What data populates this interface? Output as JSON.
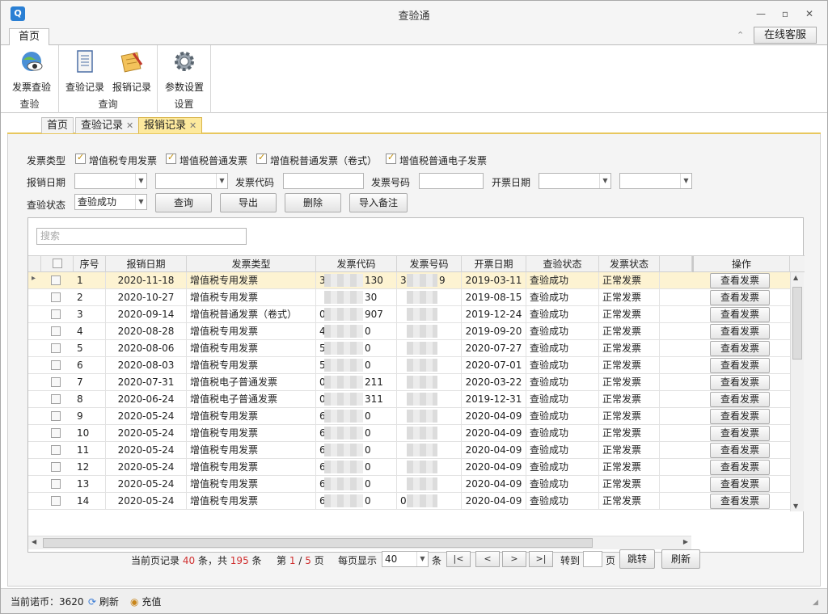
{
  "window": {
    "title": "查验通"
  },
  "ribbon": {
    "tab": "首页",
    "service_button": "在线客服",
    "groups": [
      {
        "label": "查验",
        "buttons": [
          "发票查验"
        ]
      },
      {
        "label": "查询",
        "buttons": [
          "查验记录",
          "报销记录"
        ]
      },
      {
        "label": "设置",
        "buttons": [
          "参数设置"
        ]
      }
    ]
  },
  "doc_tabs": [
    "首页",
    "查验记录",
    "报销记录"
  ],
  "filters": {
    "invoice_type_label": "发票类型",
    "types": [
      "增值税专用发票",
      "增值税普通发票",
      "增值税普通发票（卷式）",
      "增值税普通电子发票"
    ],
    "report_date_label": "报销日期",
    "code_label": "发票代码",
    "number_label": "发票号码",
    "issue_date_label": "开票日期",
    "status_label": "查验状态",
    "status_value": "查验成功",
    "buttons": [
      "查询",
      "导出",
      "删除",
      "导入备注"
    ]
  },
  "grid": {
    "search_placeholder": "搜索",
    "columns": [
      "序号",
      "报销日期",
      "发票类型",
      "发票代码",
      "发票号码",
      "开票日期",
      "查验状态",
      "发票状态",
      "操作"
    ],
    "view_label": "查看发票",
    "rows": [
      {
        "seq": "1",
        "rdate": "2020-11-18",
        "type": "增值税专用发票",
        "code_a": "3",
        "code_b": "130",
        "num_a": "3",
        "num_b": "9",
        "idate": "2019-03-11",
        "check": "查验成功",
        "state": "正常发票"
      },
      {
        "seq": "2",
        "rdate": "2020-10-27",
        "type": "增值税专用发票",
        "code_a": "",
        "code_b": "30",
        "num_a": "",
        "num_b": "",
        "idate": "2019-08-15",
        "check": "查验成功",
        "state": "正常发票"
      },
      {
        "seq": "3",
        "rdate": "2020-09-14",
        "type": "增值税普通发票（卷式）",
        "code_a": "0",
        "code_b": "907",
        "num_a": "",
        "num_b": "",
        "idate": "2019-12-24",
        "check": "查验成功",
        "state": "正常发票"
      },
      {
        "seq": "4",
        "rdate": "2020-08-28",
        "type": "增值税专用发票",
        "code_a": "4",
        "code_b": "0",
        "num_a": "",
        "num_b": "",
        "idate": "2019-09-20",
        "check": "查验成功",
        "state": "正常发票"
      },
      {
        "seq": "5",
        "rdate": "2020-08-06",
        "type": "增值税专用发票",
        "code_a": "5",
        "code_b": "0",
        "num_a": "",
        "num_b": "",
        "idate": "2020-07-27",
        "check": "查验成功",
        "state": "正常发票"
      },
      {
        "seq": "6",
        "rdate": "2020-08-03",
        "type": "增值税专用发票",
        "code_a": "5",
        "code_b": "0",
        "num_a": "",
        "num_b": "",
        "idate": "2020-07-01",
        "check": "查验成功",
        "state": "正常发票"
      },
      {
        "seq": "7",
        "rdate": "2020-07-31",
        "type": "增值税电子普通发票",
        "code_a": "0",
        "code_b": "211",
        "num_a": "",
        "num_b": "",
        "idate": "2020-03-22",
        "check": "查验成功",
        "state": "正常发票"
      },
      {
        "seq": "8",
        "rdate": "2020-06-24",
        "type": "增值税电子普通发票",
        "code_a": "0",
        "code_b": "311",
        "num_a": "",
        "num_b": "",
        "idate": "2019-12-31",
        "check": "查验成功",
        "state": "正常发票"
      },
      {
        "seq": "9",
        "rdate": "2020-05-24",
        "type": "增值税专用发票",
        "code_a": "6",
        "code_b": "0",
        "num_a": "",
        "num_b": "",
        "idate": "2020-04-09",
        "check": "查验成功",
        "state": "正常发票"
      },
      {
        "seq": "10",
        "rdate": "2020-05-24",
        "type": "增值税专用发票",
        "code_a": "6",
        "code_b": "0",
        "num_a": "",
        "num_b": "",
        "idate": "2020-04-09",
        "check": "查验成功",
        "state": "正常发票"
      },
      {
        "seq": "11",
        "rdate": "2020-05-24",
        "type": "增值税专用发票",
        "code_a": "6",
        "code_b": "0",
        "num_a": "",
        "num_b": "",
        "idate": "2020-04-09",
        "check": "查验成功",
        "state": "正常发票"
      },
      {
        "seq": "12",
        "rdate": "2020-05-24",
        "type": "增值税专用发票",
        "code_a": "6",
        "code_b": "0",
        "num_a": "",
        "num_b": "",
        "idate": "2020-04-09",
        "check": "查验成功",
        "state": "正常发票"
      },
      {
        "seq": "13",
        "rdate": "2020-05-24",
        "type": "增值税专用发票",
        "code_a": "6",
        "code_b": "0",
        "num_a": "",
        "num_b": "",
        "idate": "2020-04-09",
        "check": "查验成功",
        "state": "正常发票"
      },
      {
        "seq": "14",
        "rdate": "2020-05-24",
        "type": "增值税专用发票",
        "code_a": "6",
        "code_b": "0",
        "num_a": "0",
        "num_b": "",
        "idate": "2020-04-09",
        "check": "查验成功",
        "state": "正常发票"
      }
    ]
  },
  "pager": {
    "prefix": "当前页记录",
    "page_count": "40",
    "mid": "条，共",
    "total": "195",
    "suffix": "条",
    "page_prefix": "第",
    "page": "1",
    "slash": "/",
    "pages": "5",
    "page_suffix": "页",
    "per_label": "每页显示",
    "per_value": "40",
    "per_suffix": "条",
    "goto_label": "转到",
    "goto_suffix": "页",
    "jump": "跳转",
    "refresh": "刷新"
  },
  "status": {
    "coins_label": "当前诺币：",
    "coins": "3620",
    "refresh": "刷新",
    "recharge": "充值"
  },
  "colors": {
    "accent": "#fde99d",
    "red": "#d03030",
    "selected_row": "#fdf3d2"
  }
}
